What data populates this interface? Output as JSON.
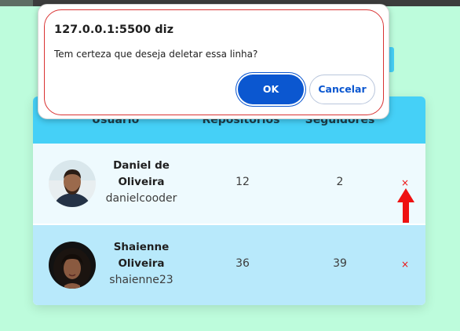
{
  "dialog": {
    "title": "127.0.0.1:5500 diz",
    "message": "Tem certeza que deseja deletar essa linha?",
    "ok_label": "OK",
    "cancel_label": "Cancelar"
  },
  "table": {
    "headers": [
      "Usuário",
      "Repositórios",
      "Seguidores",
      ""
    ],
    "rows": [
      {
        "name_line1": "Daniel de",
        "name_line2": "Oliveira",
        "login": "danielcooder",
        "repositories": "12",
        "followers": "2",
        "delete_icon": "×"
      },
      {
        "name_line1": "Shaienne",
        "name_line2": "Oliveira",
        "login": "shaienne23",
        "repositories": "36",
        "followers": "39",
        "delete_icon": "×"
      }
    ]
  },
  "colors": {
    "background": "#bdfcdc",
    "header": "#45d0f7",
    "row_odd": "#eefafe",
    "row_even": "#b8e9fb",
    "delete": "#ee1111",
    "dialog_primary": "#0b57d0"
  },
  "icons": {
    "delete": "close-icon",
    "arrow": "red-up-arrow"
  }
}
